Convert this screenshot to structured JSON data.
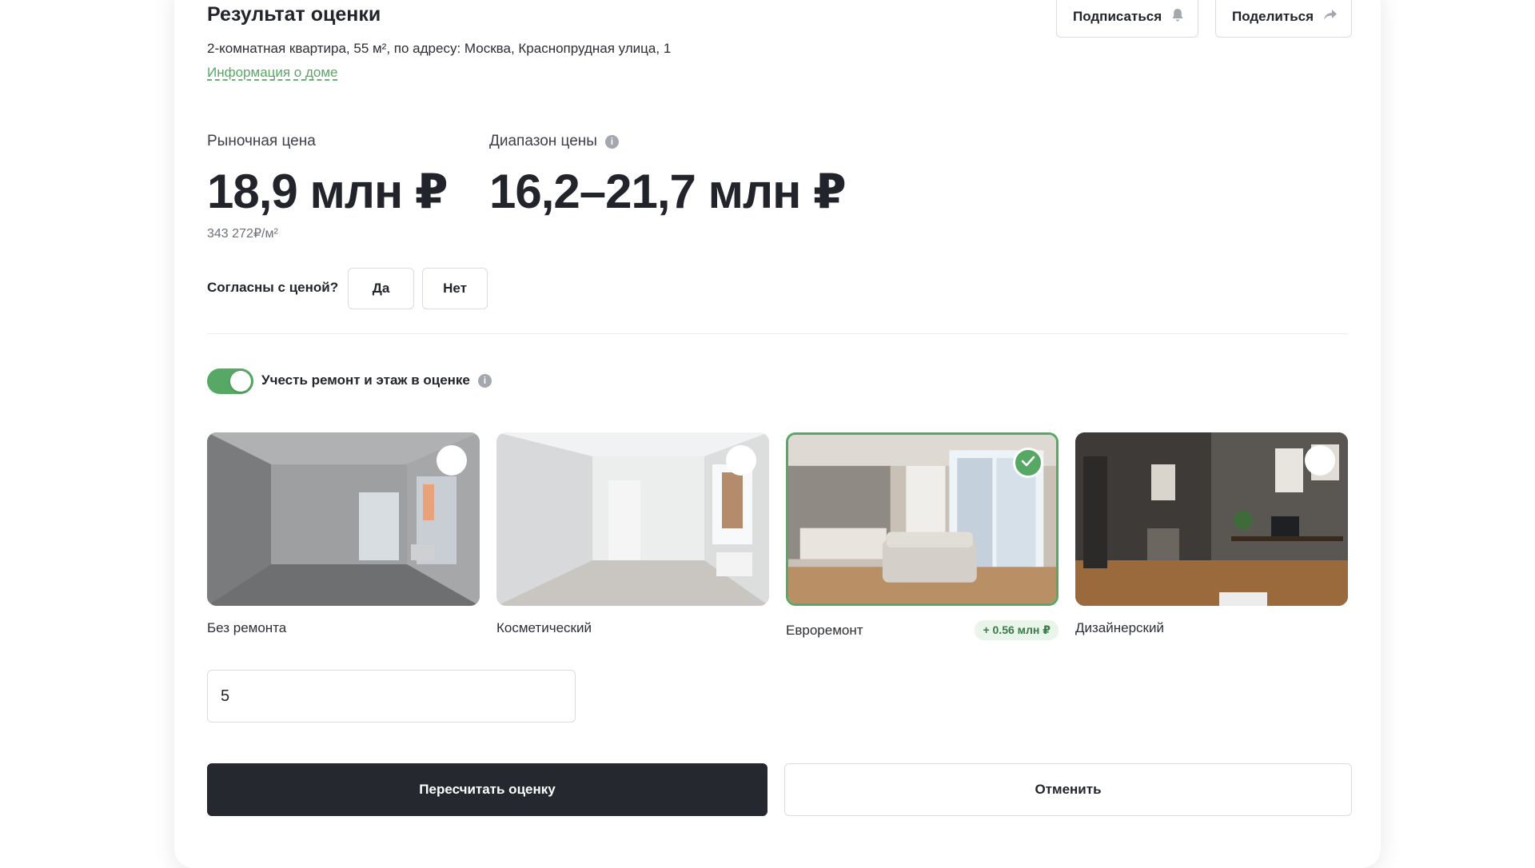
{
  "header": {
    "title": "Результат оценки",
    "subtitle": "2-комнатная квартира, 55 м², по адресу: Москва, Краснопрудная улица, 1",
    "house_link": "Информация о доме",
    "subscribe_label": "Подписаться",
    "share_label": "Поделиться"
  },
  "prices": {
    "market_label": "Рыночная цена",
    "market_value": "18,9 млн ₽",
    "per_m2": "343 272₽/м²",
    "range_label": "Диапазон цены",
    "range_value": "16,2–21,7 млн ₽"
  },
  "agree": {
    "question": "Согласны с ценой?",
    "yes": "Да",
    "no": "Нет"
  },
  "toggle": {
    "label": "Учесть ремонт и этаж в оценке",
    "on": true
  },
  "renovations": [
    {
      "label": "Без ремонта",
      "selected": false,
      "badge": ""
    },
    {
      "label": "Косметический",
      "selected": false,
      "badge": ""
    },
    {
      "label": "Евроремонт",
      "selected": true,
      "badge": "+ 0.56 млн ₽"
    },
    {
      "label": "Дизайнерский",
      "selected": false,
      "badge": ""
    }
  ],
  "floor": {
    "value": "5"
  },
  "actions": {
    "recalc": "Пересчитать оценку",
    "cancel": "Отменить"
  },
  "colors": {
    "accent": "#58a865",
    "dark_button": "#25282e"
  }
}
